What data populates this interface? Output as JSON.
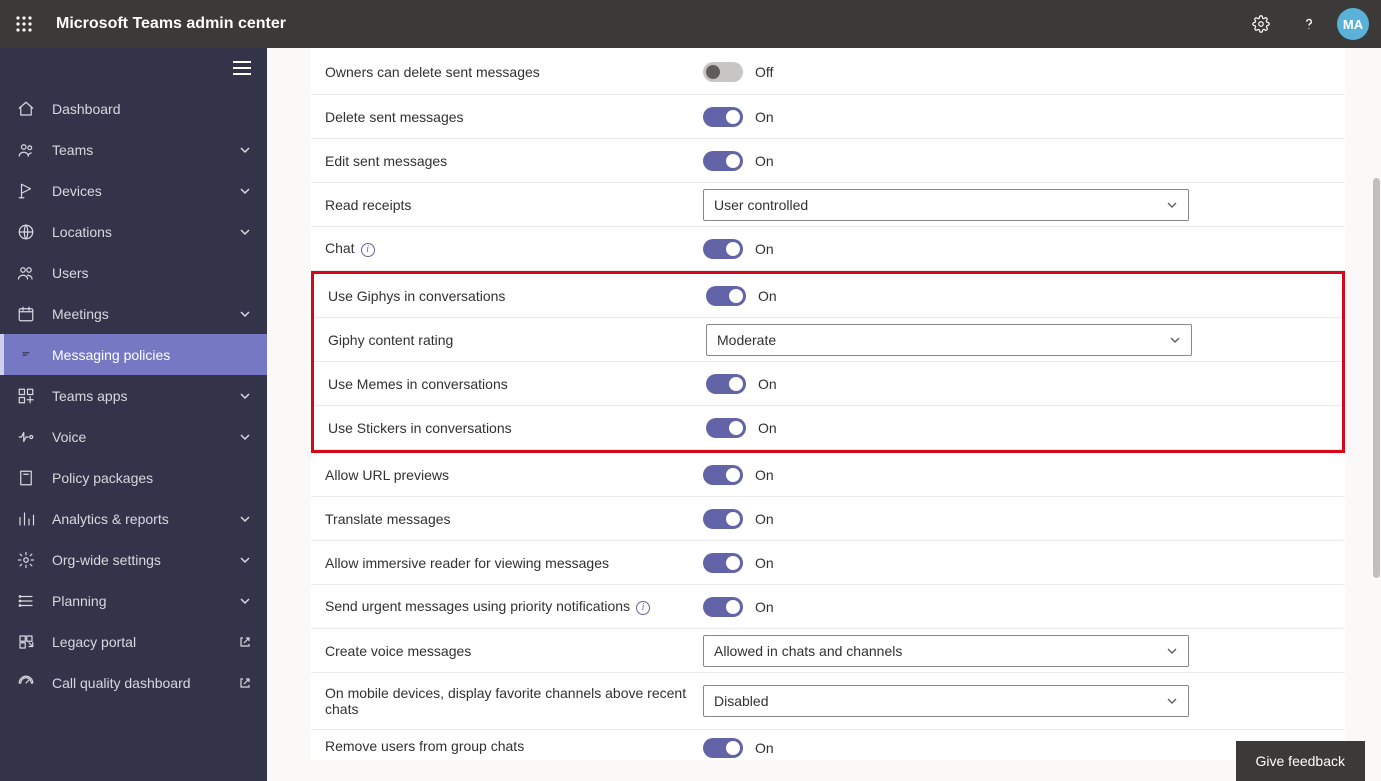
{
  "header": {
    "title": "Microsoft Teams admin center",
    "avatar_initials": "MA"
  },
  "sidebar": {
    "items": [
      {
        "label": "Dashboard",
        "icon": "home",
        "expandable": false,
        "external": false
      },
      {
        "label": "Teams",
        "icon": "teams",
        "expandable": true,
        "external": false
      },
      {
        "label": "Devices",
        "icon": "devices",
        "expandable": true,
        "external": false
      },
      {
        "label": "Locations",
        "icon": "globe",
        "expandable": true,
        "external": false
      },
      {
        "label": "Users",
        "icon": "users",
        "expandable": false,
        "external": false
      },
      {
        "label": "Meetings",
        "icon": "calendar",
        "expandable": true,
        "external": false
      },
      {
        "label": "Messaging policies",
        "icon": "chat",
        "expandable": false,
        "external": false,
        "active": true
      },
      {
        "label": "Teams apps",
        "icon": "apps",
        "expandable": true,
        "external": false
      },
      {
        "label": "Voice",
        "icon": "voice",
        "expandable": true,
        "external": false
      },
      {
        "label": "Policy packages",
        "icon": "package",
        "expandable": false,
        "external": false
      },
      {
        "label": "Analytics & reports",
        "icon": "analytics",
        "expandable": true,
        "external": false
      },
      {
        "label": "Org-wide settings",
        "icon": "gear",
        "expandable": true,
        "external": false
      },
      {
        "label": "Planning",
        "icon": "planning",
        "expandable": true,
        "external": false
      },
      {
        "label": "Legacy portal",
        "icon": "legacy",
        "expandable": false,
        "external": true
      },
      {
        "label": "Call quality dashboard",
        "icon": "speed",
        "expandable": false,
        "external": true
      }
    ]
  },
  "settings": [
    {
      "label": "Owners can delete sent messages",
      "type": "toggle",
      "value": false,
      "text_off": "Off"
    },
    {
      "label": "Delete sent messages",
      "type": "toggle",
      "value": true,
      "text_on": "On"
    },
    {
      "label": "Edit sent messages",
      "type": "toggle",
      "value": true,
      "text_on": "On"
    },
    {
      "label": "Read receipts",
      "type": "select",
      "value": "User controlled"
    },
    {
      "label": "Chat",
      "type": "toggle",
      "value": true,
      "text_on": "On",
      "info": true
    },
    {
      "label": "Use Giphys in conversations",
      "type": "toggle",
      "value": true,
      "text_on": "On",
      "group": "highlight"
    },
    {
      "label": "Giphy content rating",
      "type": "select",
      "value": "Moderate",
      "group": "highlight"
    },
    {
      "label": "Use Memes in conversations",
      "type": "toggle",
      "value": true,
      "text_on": "On",
      "group": "highlight"
    },
    {
      "label": "Use Stickers in conversations",
      "type": "toggle",
      "value": true,
      "text_on": "On",
      "group": "highlight"
    },
    {
      "label": "Allow URL previews",
      "type": "toggle",
      "value": true,
      "text_on": "On"
    },
    {
      "label": "Translate messages",
      "type": "toggle",
      "value": true,
      "text_on": "On"
    },
    {
      "label": "Allow immersive reader for viewing messages",
      "type": "toggle",
      "value": true,
      "text_on": "On"
    },
    {
      "label": "Send urgent messages using priority notifications",
      "type": "toggle",
      "value": true,
      "text_on": "On",
      "info": true
    },
    {
      "label": "Create voice messages",
      "type": "select",
      "value": "Allowed in chats and channels"
    },
    {
      "label": "On mobile devices, display favorite channels above recent chats",
      "type": "select",
      "value": "Disabled",
      "tall": true
    },
    {
      "label": "Remove users from group chats",
      "type": "toggle",
      "value": true,
      "text_on": "On",
      "cut": true
    }
  ],
  "feedback": {
    "label": "Give feedback"
  },
  "colors": {
    "accent": "#6264a7",
    "highlight_border": "#d8061a",
    "sidebar_bg": "#33344a",
    "topbar_bg": "#3b3a39"
  }
}
